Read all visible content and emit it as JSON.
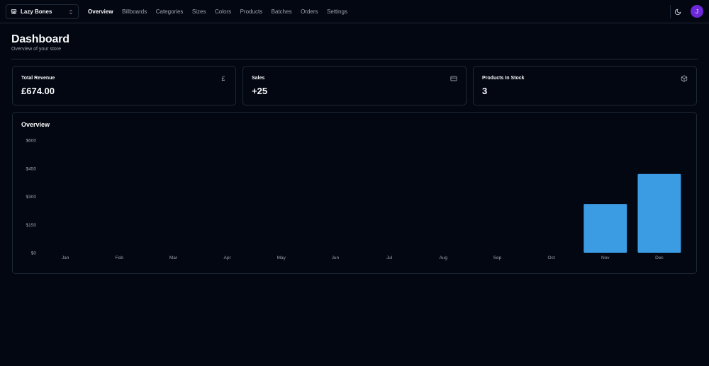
{
  "store_switcher": {
    "name": "Lazy Bones",
    "store_icon": "store-icon",
    "chevron_icon": "chevrons-up-down-icon"
  },
  "nav": {
    "items": [
      {
        "label": "Overview",
        "active": true
      },
      {
        "label": "Billboards",
        "active": false
      },
      {
        "label": "Categories",
        "active": false
      },
      {
        "label": "Sizes",
        "active": false
      },
      {
        "label": "Colors",
        "active": false
      },
      {
        "label": "Products",
        "active": false
      },
      {
        "label": "Batches",
        "active": false
      },
      {
        "label": "Orders",
        "active": false
      },
      {
        "label": "Settings",
        "active": false
      }
    ]
  },
  "header_right": {
    "theme_icon": "moon-icon",
    "avatar_initial": "J",
    "avatar_color": "#6d28d9"
  },
  "page": {
    "title": "Dashboard",
    "subtitle": "Overview of your store"
  },
  "stats": [
    {
      "title": "Total Revenue",
      "value": "£674.00",
      "icon": "pound-icon"
    },
    {
      "title": "Sales",
      "value": "+25",
      "icon": "credit-card-icon"
    },
    {
      "title": "Products In Stock",
      "value": "3",
      "icon": "package-icon"
    }
  ],
  "overview": {
    "title": "Overview"
  },
  "colors": {
    "background": "#030712",
    "border": "#1f2937",
    "bar": "#3b9be3",
    "muted": "#9ca3af"
  },
  "chart_data": {
    "type": "bar",
    "title": "Overview",
    "categories": [
      "Jan",
      "Feb",
      "Mar",
      "Apr",
      "May",
      "Jun",
      "Jul",
      "Aug",
      "Sep",
      "Oct",
      "Nov",
      "Dec"
    ],
    "values": [
      0,
      0,
      0,
      0,
      0,
      0,
      0,
      0,
      0,
      0,
      260,
      420
    ],
    "ylim": [
      0,
      600
    ],
    "yticks": [
      0,
      150,
      300,
      450,
      600
    ],
    "ytick_labels": [
      "$0",
      "$150",
      "$300",
      "$450",
      "$600"
    ],
    "grid": false,
    "xlabel": "",
    "ylabel": ""
  }
}
